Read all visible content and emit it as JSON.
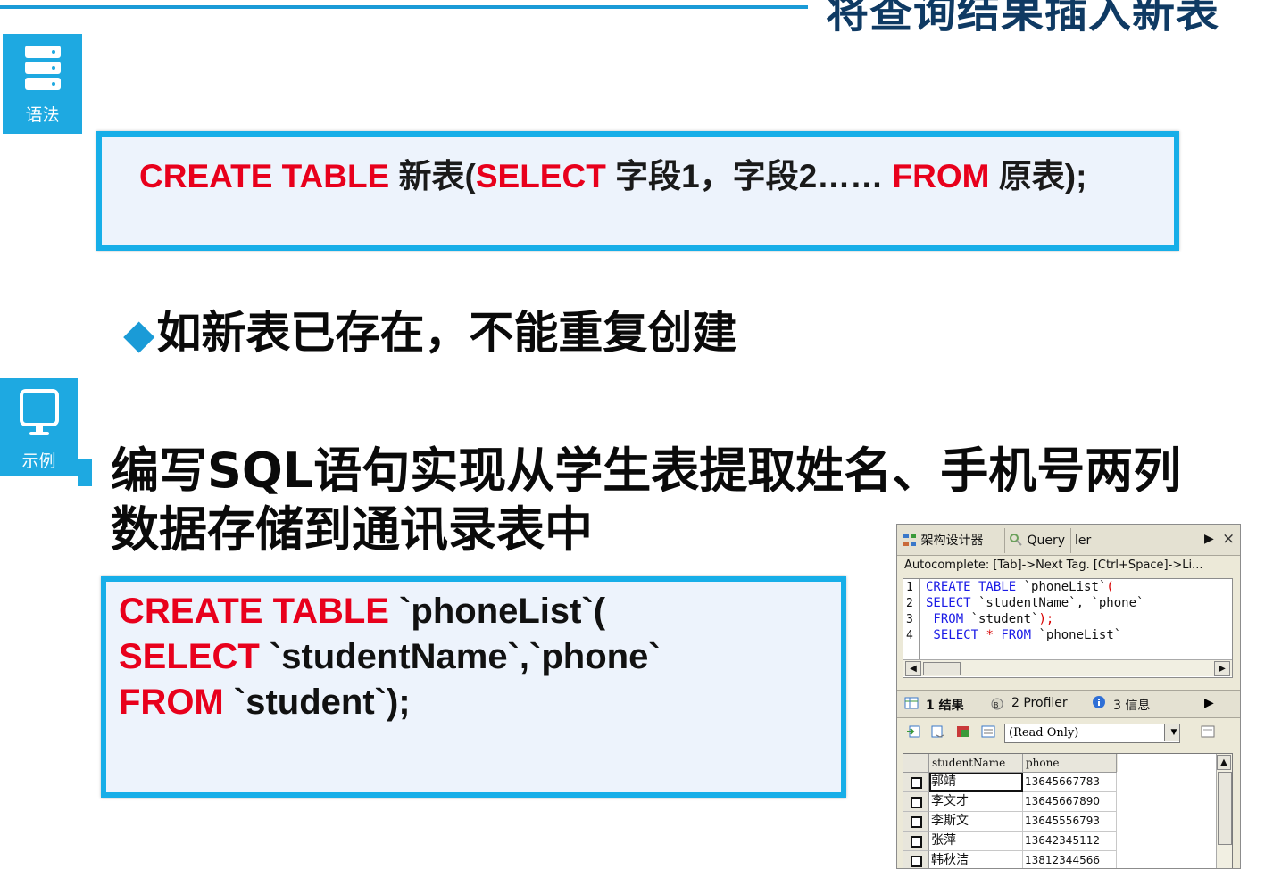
{
  "slide": {
    "title": "将查询结果插入新表",
    "syntax_tag": "语法",
    "example_tag": "示例",
    "syntax": {
      "kw_create_table": "CREATE TABLE",
      "t_new_table": " 新表(",
      "kw_select": "SELECT",
      "t_fields": " 字段1，字段2……  ",
      "kw_from": "FROM",
      "t_orig": " 原表);"
    },
    "note_bullet": "◆",
    "note": "如新表已存在，不能重复创建",
    "task": "编写SQL语句实现从学生表提取姓名、手机号两列数据存储到通讯录表中",
    "example": {
      "l1_kw": "CREATE TABLE",
      "l1_tx": " `phoneList`(",
      "l2_kw": "SELECT",
      "l2_tx": " `studentName`,`phone`",
      "l3_kw": "FROM",
      "l3_tx": " `student`);"
    }
  },
  "ide": {
    "tabs": [
      "架构设计器",
      "Query",
      "ler"
    ],
    "autocomplete": "Autocomplete: [Tab]->Next Tag. [Ctrl+Space]->Li...",
    "line_numbers": [
      "1",
      "2",
      "3",
      "4"
    ],
    "code": {
      "l1_kw": "CREATE TABLE",
      "l1_tx": " `phoneList`",
      "l1_pn": "(",
      "l2_kw": "SELECT",
      "l2_tx": " `studentName`, `phone`",
      "l3_kw": " FROM",
      "l3_tx": " `student`",
      "l3_pn": ");",
      "l4_kw": " SELECT",
      "l4_star": " * ",
      "l4_kw2": "FROM",
      "l4_tx": " `phoneList`"
    },
    "result_tabs": [
      "1 结果",
      "2 Profiler",
      "3 信息"
    ],
    "readonly": "(Read Only)",
    "columns": [
      "studentName",
      "phone"
    ],
    "rows": [
      {
        "name": "郭靖",
        "phone": "13645667783"
      },
      {
        "name": "李文才",
        "phone": "13645667890"
      },
      {
        "name": "李斯文",
        "phone": "13645556793"
      },
      {
        "name": "张萍",
        "phone": "13642345112"
      },
      {
        "name": "韩秋洁",
        "phone": "13812344566"
      }
    ],
    "colors": {
      "keyword": "#1a1ae6",
      "paren": "#d80000"
    }
  }
}
